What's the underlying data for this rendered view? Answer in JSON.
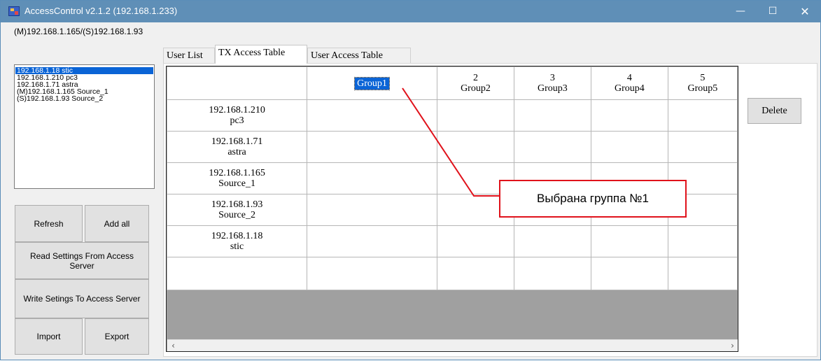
{
  "window": {
    "title": "AccessControl v2.1.2 (192.168.1.233)",
    "controls": {
      "minimize": "—",
      "maximize": "☐",
      "close": "✕"
    }
  },
  "connection_label": "(M)192.168.1.165/(S)192.168.1.93",
  "device_list": [
    {
      "text": "192.168.1.18 stic",
      "selected": true
    },
    {
      "text": "192.168.1.210 pc3",
      "selected": false
    },
    {
      "text": "192.168.1.71 astra",
      "selected": false
    },
    {
      "text": "(M)192.168.1.165 Source_1",
      "selected": false
    },
    {
      "text": "(S)192.168.1.93 Source_2",
      "selected": false
    }
  ],
  "buttons": {
    "refresh": "Refresh",
    "add_all": "Add all",
    "read": "Read Settings From Access Server",
    "write": "Write Setings To Access Server",
    "import": "Import",
    "export": "Export",
    "delete": "Delete"
  },
  "tabs": [
    "User List",
    "TX Access Table",
    "User Access Table"
  ],
  "active_tab": "TX Access Table",
  "table": {
    "groups": [
      {
        "num": "",
        "name": "Group1",
        "selected": true
      },
      {
        "num": "2",
        "name": "Group2"
      },
      {
        "num": "3",
        "name": "Group3"
      },
      {
        "num": "4",
        "name": "Group4"
      },
      {
        "num": "5",
        "name": "Group5"
      }
    ],
    "rows": [
      {
        "ip": "192.168.1.210",
        "name": "pc3"
      },
      {
        "ip": "192.168.1.71",
        "name": "astra"
      },
      {
        "ip": "192.168.1.165",
        "name": "Source_1"
      },
      {
        "ip": "192.168.1.93",
        "name": "Source_2"
      },
      {
        "ip": "192.168.1.18",
        "name": "stic"
      }
    ]
  },
  "scrollbar": {
    "left": "‹",
    "right": "›"
  },
  "annotation": {
    "text": "Выбрана группа №1",
    "color": "#e0121b"
  }
}
